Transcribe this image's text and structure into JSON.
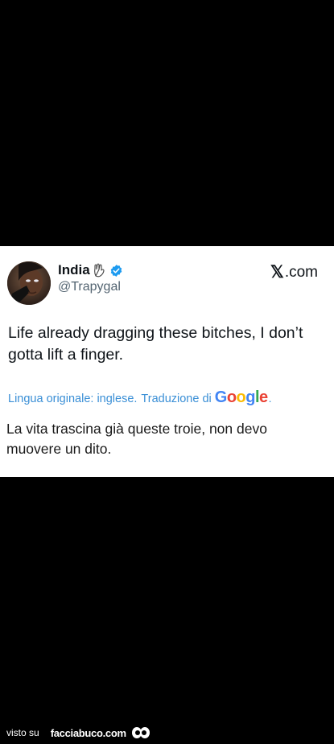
{
  "tweet": {
    "display_name": "India",
    "handle": "@Trapygal",
    "source_label": ".com",
    "source_logo": "𝕏",
    "text": "Life already dragging these bitches, I don’t gotta lift a finger.",
    "translation_label": "Lingua originale: inglese.",
    "translated_by": "Traduzione di",
    "google_letters": [
      "G",
      "o",
      "o",
      "g",
      "l",
      "e"
    ],
    "translation_dot": ".",
    "translated_text": "La vita trascina già queste troie, non devo muovere un dito."
  },
  "footer": {
    "prefix": "visto su",
    "brand": "facciabuco.com"
  },
  "colors": {
    "verified_blue": "#1d9bf0",
    "link_blue": "#3a8fd6"
  },
  "icons": [
    "waving-hand-icon",
    "verified-badge-icon",
    "x-logo-icon",
    "eyes-icon"
  ]
}
